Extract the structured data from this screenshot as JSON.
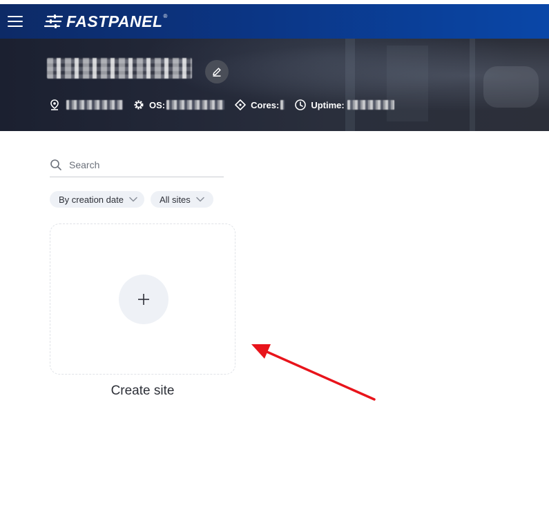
{
  "header": {
    "brand": "FASTPANEL",
    "brand_mark": "®"
  },
  "server": {
    "os_label": "OS:",
    "cores_label": "Cores:",
    "uptime_label": "Uptime:"
  },
  "search": {
    "placeholder": "Search"
  },
  "filters": {
    "sort_label": "By creation date",
    "type_label": "All sites"
  },
  "create_site": {
    "label": "Create site"
  },
  "annotation": {
    "arrow_color": "#e8141b"
  },
  "colors": {
    "header_bg": "#0b3584",
    "chip_bg": "#eef1f6"
  }
}
